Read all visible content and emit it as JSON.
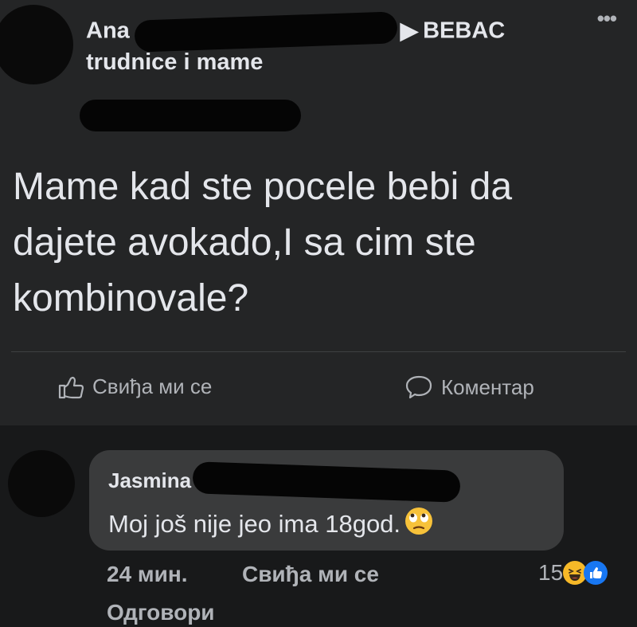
{
  "post": {
    "author": "Ana",
    "target_group": "BEBAC",
    "group_line2": "trudnice i mame",
    "more_icon": "more-dots-icon",
    "text": "Mame kad ste pocele bebi da dajete avokado,I sa cim ste kombinovale?",
    "like_label": "Свиђа ми се",
    "comment_label": "Коментар"
  },
  "comment": {
    "author": "Jasmina",
    "text": "Moj još nije jeo ima 18god.",
    "emoji": "face-with-rolling-eyes",
    "time": "24 мин.",
    "like_label": "Свиђа ми се",
    "reply_label": "Одговори",
    "reaction_count": "15",
    "reaction_icons": [
      "laughing-face-icon",
      "thumbs-up-icon"
    ]
  },
  "colors": {
    "background": "#18191a",
    "card": "#242526",
    "bubble": "#3a3b3c",
    "text_primary": "#e4e6eb",
    "text_secondary": "#b0b3b8",
    "like_blue": "#1877f2",
    "haha_yellow": "#f7b928"
  }
}
